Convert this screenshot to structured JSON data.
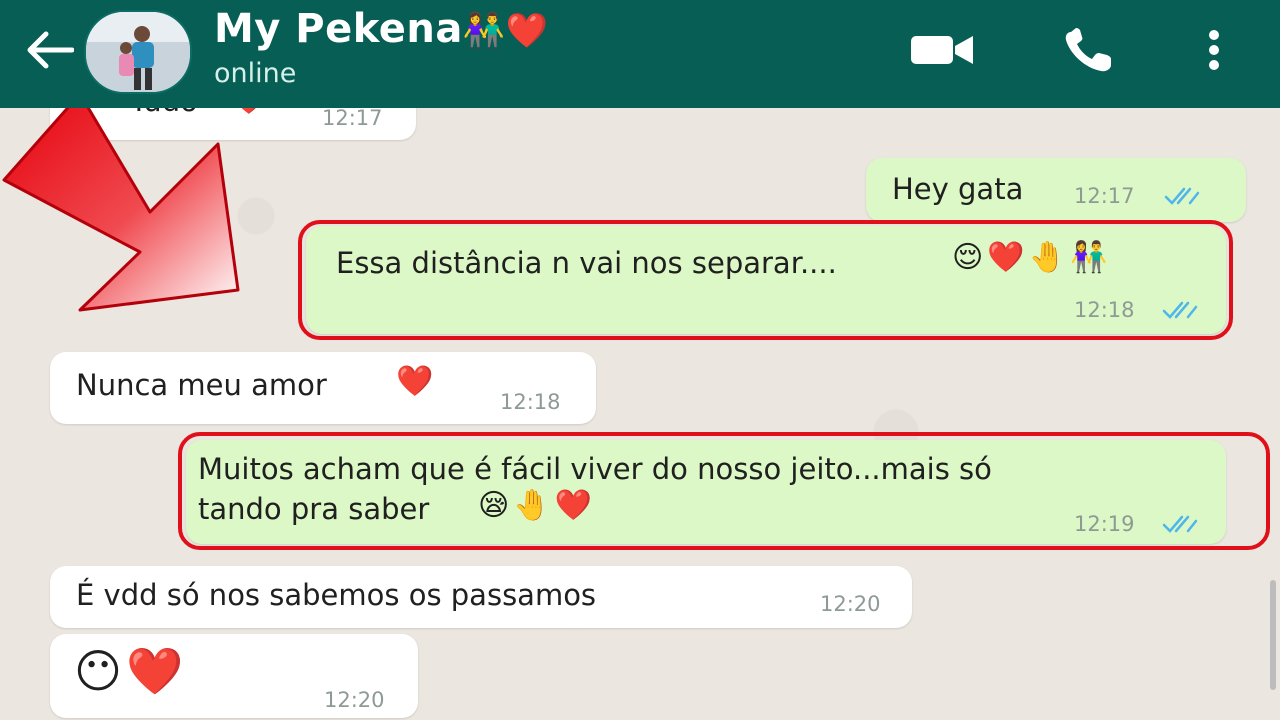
{
  "header": {
    "contact_name": "My Pekena",
    "contact_emojis": "👫❤️",
    "status": "online",
    "icons": {
      "back": "arrow-left-icon",
      "video": "video-call-icon",
      "call": "phone-icon",
      "menu": "more-vertical-icon"
    }
  },
  "messages": [
    {
      "id": "m0",
      "direction": "incoming",
      "text": "Tudo",
      "emoji": "❤️",
      "time": "12:17"
    },
    {
      "id": "m1",
      "direction": "outgoing",
      "text": "Hey gata",
      "time": "12:17",
      "status": "read"
    },
    {
      "id": "m2",
      "direction": "outgoing",
      "text": "Essa distância n vai nos separar....",
      "emoji": "😌❤️🤚👫",
      "time": "12:18",
      "status": "read",
      "highlighted": true
    },
    {
      "id": "m3",
      "direction": "incoming",
      "text": "Nunca meu amor",
      "emoji": "❤️",
      "time": "12:18"
    },
    {
      "id": "m4",
      "direction": "outgoing",
      "line1": "Muitos acham que é fácil viver do nosso jeito...mais só",
      "line2": "tando pra saber",
      "emoji": "😪🤚❤️",
      "time": "12:19",
      "status": "read",
      "highlighted": true
    },
    {
      "id": "m5",
      "direction": "incoming",
      "text": "É vdd só nos sabemos os passamos",
      "time": "12:20"
    },
    {
      "id": "m6",
      "direction": "incoming",
      "emoji": "😶❤️",
      "time": "12:20"
    }
  ],
  "colors": {
    "header": "#075e55",
    "incoming_bubble": "#ffffff",
    "outgoing_bubble": "#dcf8c6",
    "read_ticks": "#4fb6ec",
    "highlight": "#e0101a"
  }
}
